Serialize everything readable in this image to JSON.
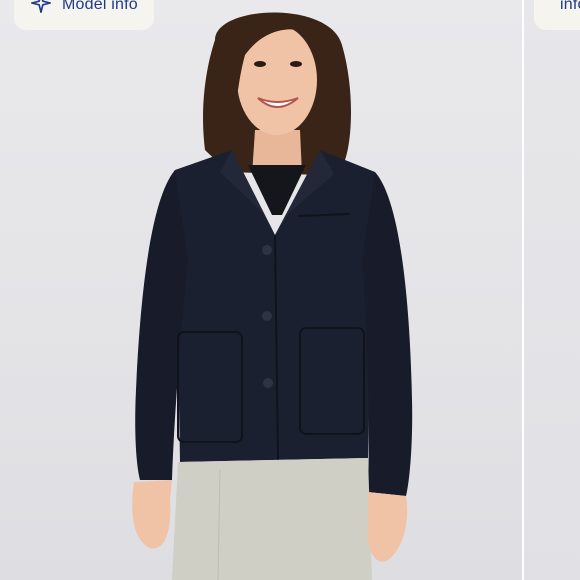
{
  "model_info_button": {
    "label": "Model info",
    "icon": "sparkle-icon",
    "color": "#1e3a8a"
  },
  "next_card": {
    "label": "Model info",
    "icon": "sparkle-icon"
  },
  "product": {
    "jacket_color": "#1b2030",
    "skirt_color": "#cfcfc5"
  }
}
